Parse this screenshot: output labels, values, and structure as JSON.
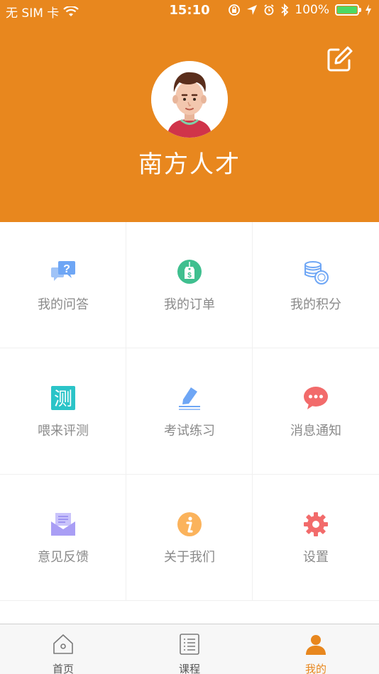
{
  "status_bar": {
    "carrier": "无 SIM 卡",
    "time": "15:10",
    "battery": "100%"
  },
  "profile": {
    "name": "南方人才"
  },
  "menu": [
    {
      "label": "我的问答",
      "icon": "question-chat-icon",
      "color": "#6ea6f5"
    },
    {
      "label": "我的订单",
      "icon": "price-tag-icon",
      "color": "#3fbf8f"
    },
    {
      "label": "我的积分",
      "icon": "coins-icon",
      "color": "#6ea6f5"
    },
    {
      "label": "喂来评测",
      "icon": "test-icon",
      "color": "#2bc4c8"
    },
    {
      "label": "考试练习",
      "icon": "pen-icon",
      "color": "#6ea6f5"
    },
    {
      "label": "消息通知",
      "icon": "message-icon",
      "color": "#f26b6b"
    },
    {
      "label": "意见反馈",
      "icon": "envelope-icon",
      "color": "#a99ef5"
    },
    {
      "label": "关于我们",
      "icon": "info-icon",
      "color": "#fbb35c"
    },
    {
      "label": "设置",
      "icon": "gear-icon",
      "color": "#f26b6b"
    }
  ],
  "test_icon_char": "测",
  "tabs": [
    {
      "label": "首页",
      "icon": "home-icon"
    },
    {
      "label": "课程",
      "icon": "course-list-icon"
    },
    {
      "label": "我的",
      "icon": "person-icon"
    }
  ],
  "colors": {
    "brand": "#e8871e",
    "label_gray": "#8a8a8a"
  }
}
